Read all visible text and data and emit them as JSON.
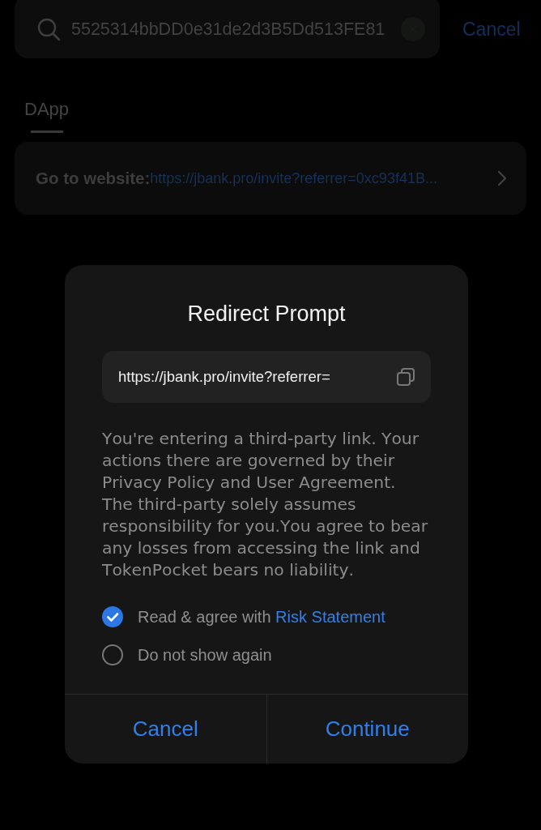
{
  "search": {
    "value": "5525314bbDD0e31de2d3B5Dd513FE81",
    "cancel": "Cancel"
  },
  "tabs": [
    {
      "label": "DApp",
      "selected": true
    }
  ],
  "result": {
    "label": "Go to website:",
    "url": "https://jbank.pro/invite?referrer=0xc93f41B..."
  },
  "dialog": {
    "title": "Redirect Prompt",
    "url": "https://jbank.pro/invite?referrer=",
    "message": "You're entering a third-party link. Your actions there are governed by their Privacy Policy and User Agreement. The third-party solely assumes responsibility for you.You agree to bear any losses from accessing the link and TokenPocket bears no liability.",
    "options": [
      {
        "text": "Read & agree with",
        "link": "Risk Statement",
        "checked": true
      },
      {
        "text": "Do not show again",
        "checked": false
      }
    ],
    "buttons": [
      "Cancel",
      "Continue"
    ]
  }
}
